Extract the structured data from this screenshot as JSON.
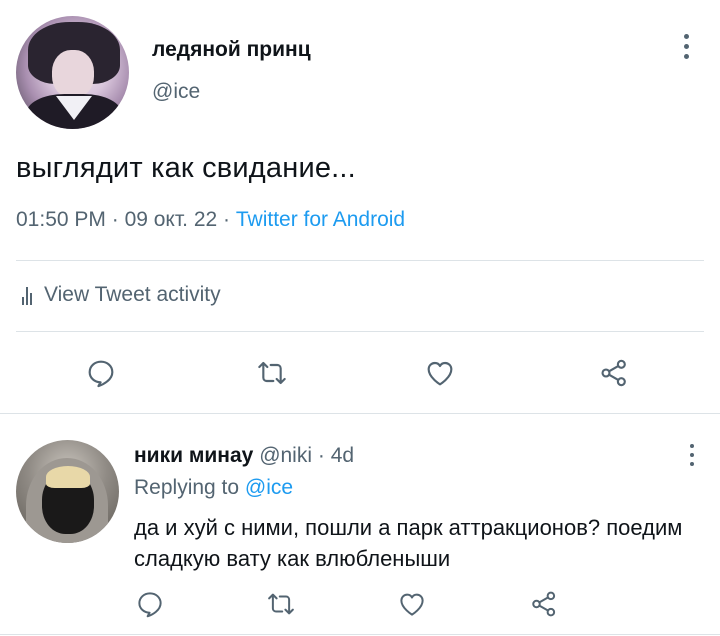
{
  "tweet": {
    "display_name": "ледяной принц",
    "handle": "@ice",
    "text": "выглядит как свидание...",
    "time": "01:50 PM",
    "date": "09 окт. 22",
    "source": "Twitter for Android",
    "activity_label": "View Tweet activity",
    "actions": [
      "reply-icon",
      "retweet-icon",
      "like-icon",
      "share-icon"
    ]
  },
  "reply": {
    "display_name": "ники минау",
    "handle": "@niki",
    "age": "4d",
    "replying_prefix": "Replying to",
    "replying_to": "@ice",
    "text": "да и хуй с ними, пошли а парк аттракционов? поедим сладкую вату как влюбленыши",
    "actions": [
      "reply-icon",
      "retweet-icon",
      "like-icon",
      "share-icon"
    ]
  },
  "colors": {
    "text": "#0f1419",
    "secondary": "#536471",
    "link": "#1d9bf0",
    "divider": "#dde3e7"
  }
}
